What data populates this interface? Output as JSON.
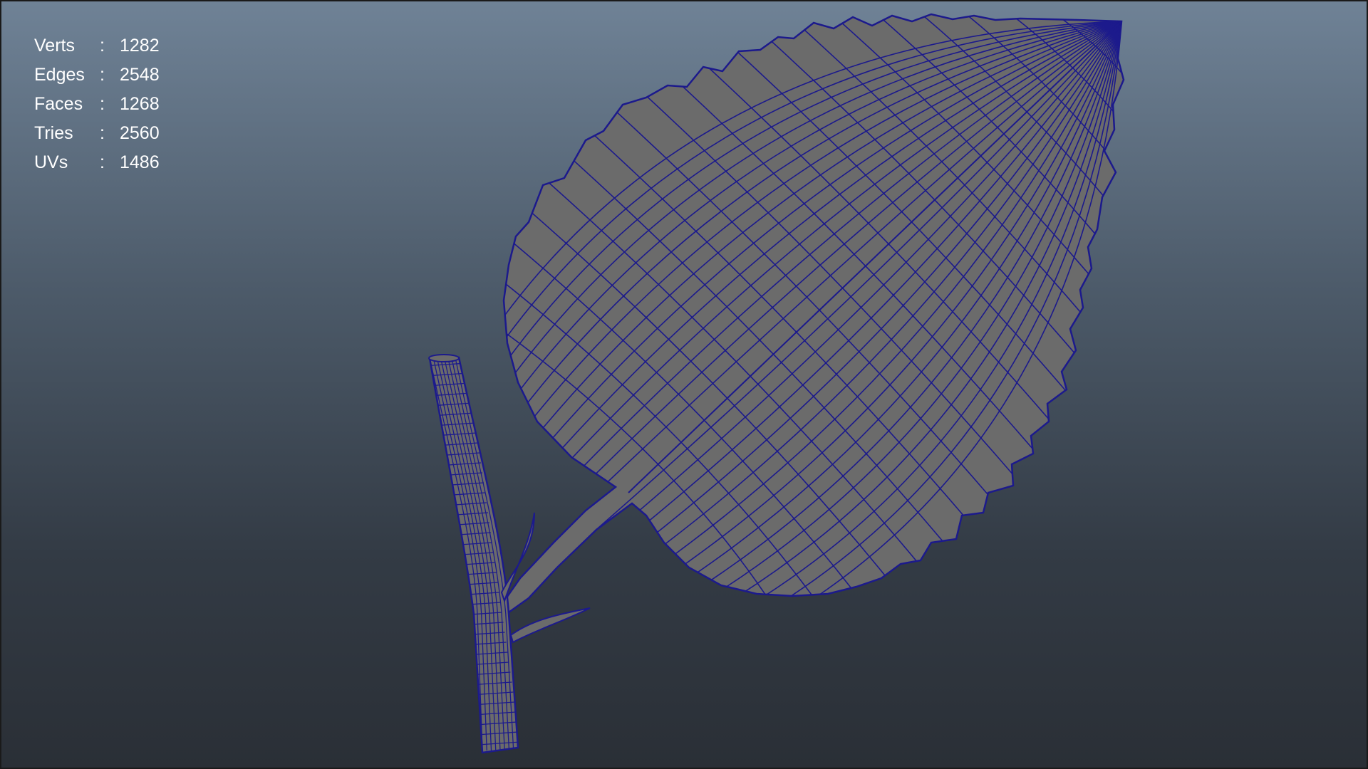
{
  "hud": {
    "rows": [
      {
        "label": "Verts",
        "sep": ":",
        "value": "1282"
      },
      {
        "label": "Edges",
        "sep": ":",
        "value": "2548"
      },
      {
        "label": "Faces",
        "sep": ":",
        "value": "1268"
      },
      {
        "label": "Tries",
        "sep": ":",
        "value": "2560"
      },
      {
        "label": "UVs",
        "sep": ":",
        "value": "1486"
      }
    ]
  },
  "scene": {
    "wire_color": "#1c1a8c",
    "surface_color": "#6b6b6b",
    "objects": [
      "leaf-mesh",
      "stem-mesh"
    ]
  }
}
